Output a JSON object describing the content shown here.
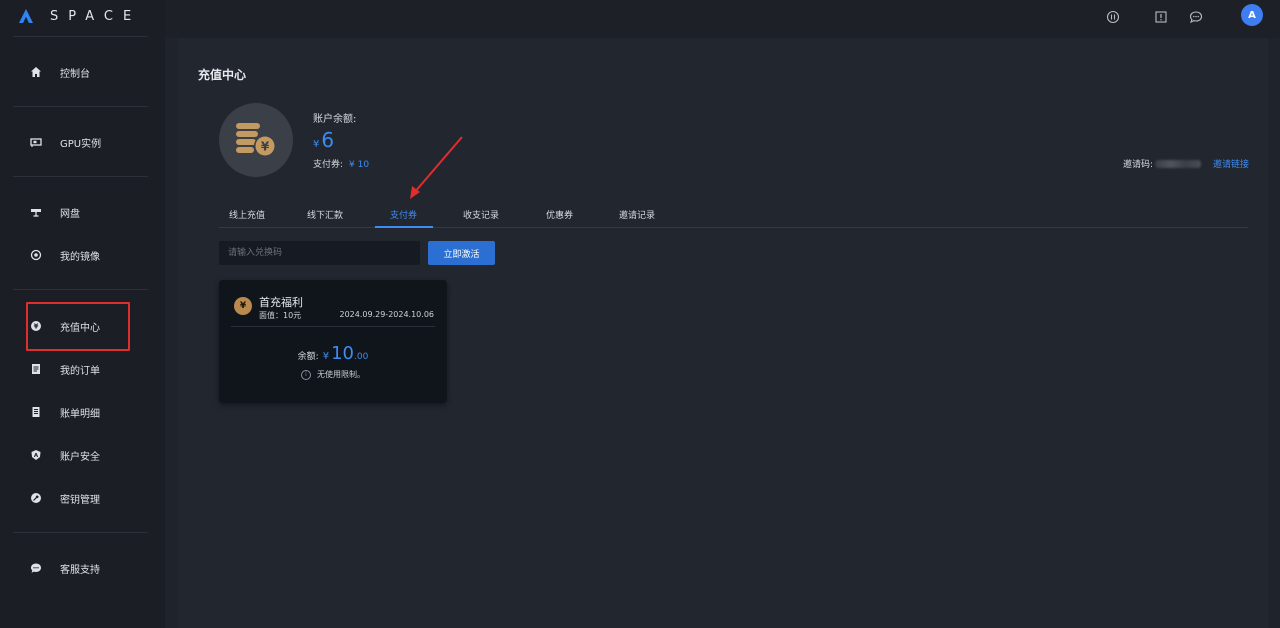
{
  "brand": {
    "name": "SPACE",
    "accent": "#3e8cf0"
  },
  "sidebar": {
    "items": [
      {
        "label": "控制台",
        "icon": "home-icon"
      },
      {
        "label": "GPU实例",
        "icon": "gpu-icon"
      },
      {
        "label": "网盘",
        "icon": "disk-icon"
      },
      {
        "label": "我的镜像",
        "icon": "image-icon"
      },
      {
        "label": "充值中心",
        "icon": "yen-icon",
        "highlighted": true
      },
      {
        "label": "我的订单",
        "icon": "order-icon"
      },
      {
        "label": "账单明细",
        "icon": "bill-icon"
      },
      {
        "label": "账户安全",
        "icon": "shield-icon"
      },
      {
        "label": "密钥管理",
        "icon": "key-icon"
      },
      {
        "label": "客服支持",
        "icon": "chat-icon"
      }
    ]
  },
  "topbar": {
    "icons": [
      "help-icon",
      "book-icon",
      "message-icon"
    ],
    "avatar_initial": "A"
  },
  "page": {
    "title": "充值中心",
    "balance_label": "账户余额:",
    "currency": "¥",
    "balance": "6",
    "voucher_label": "支付券:",
    "voucher_value": "¥ 10",
    "invite_label": "邀请码:",
    "invite_link": "邀请链接"
  },
  "tabs": [
    {
      "label": "线上充值"
    },
    {
      "label": "线下汇款"
    },
    {
      "label": "支付券",
      "active": true
    },
    {
      "label": "收支记录"
    },
    {
      "label": "优惠券"
    },
    {
      "label": "邀请记录"
    }
  ],
  "redeem": {
    "placeholder": "请输入兑换码",
    "button": "立即激活"
  },
  "voucher_card": {
    "coin": "¥",
    "title": "首充福利",
    "face_value": "面值：10元",
    "date_range": "2024.09.29-2024.10.06",
    "remaining_label": "余额:",
    "currency": "¥",
    "remaining_int": "10",
    "remaining_dec": ".00",
    "note_icon": "info-icon",
    "note": "无使用限制。"
  }
}
